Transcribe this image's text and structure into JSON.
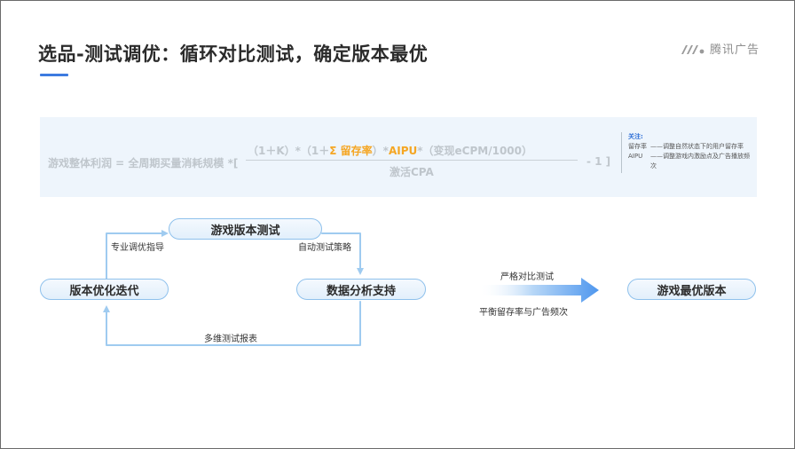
{
  "header": {
    "title": "选品-测试调优：循环对比测试，确定版本最优",
    "logo_text": "腾讯广告"
  },
  "formula": {
    "lhs": "游戏整体利润 = 全周期买量消耗规模 *[",
    "numerator_part1": "（1＋K）*（1＋",
    "highlight_retention": "Σ 留存率",
    "numerator_part2": "）*",
    "highlight_aipu": "AIPU",
    "numerator_part3": "*（变现eCPM/1000）",
    "denominator": "激活CPA",
    "tail": "- 1 ]",
    "notes_title": "关注:",
    "notes": [
      {
        "key": "留存率",
        "value": "——调整自然状态下的用户留存率"
      },
      {
        "key": "AIPU",
        "value": "——调整游戏内激励点及广告播放频次"
      }
    ]
  },
  "flow": {
    "nodes": {
      "top": "游戏版本测试",
      "left": "版本优化迭代",
      "right": "数据分析支持",
      "result": "游戏最优版本"
    },
    "edges": {
      "left_to_top": "专业调优指导",
      "top_to_right": "自动测试策略",
      "right_to_left": "多维测试报表"
    },
    "arrow_labels": {
      "upper": "严格对比测试",
      "lower": "平衡留存率与广告频次"
    }
  },
  "colors": {
    "title_accent": "#3d7be0",
    "highlight": "#f5a623",
    "node_border": "#8fc1ec",
    "arrow": "#5aa0ef"
  }
}
